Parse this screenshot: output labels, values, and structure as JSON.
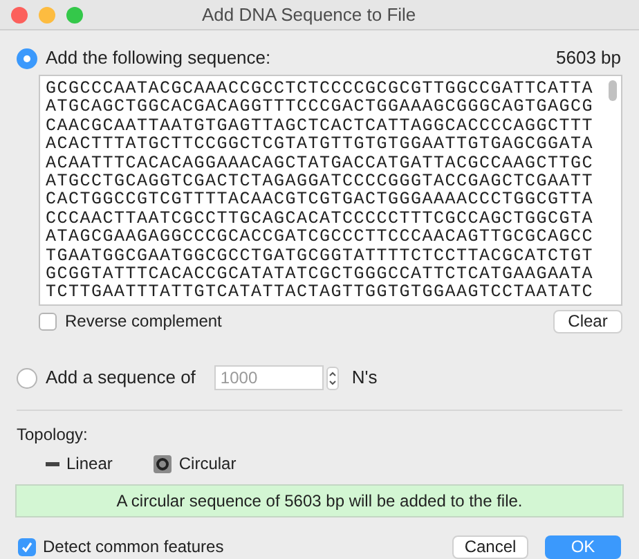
{
  "window": {
    "title": "Add DNA Sequence to File"
  },
  "source_options": [
    {
      "kind": "sequence",
      "label": "Add the following sequence:",
      "selected": true,
      "length": "5603 bp",
      "sequence_lines": [
        "GCGCCCAATACGCAAACCGCCTCTCCCCGCGCGTTGGCCGATTCATTA",
        "ATGCAGCTGGCACGACAGGTTTCCCGACTGGAAAGCGGGCAGTGAGCG",
        "CAACGCAATTAATGTGAGTTAGCTCACTCATTAGGCACCCCAGGCTTT",
        "ACACTTTATGCTTCCGGCTCGTATGTTGTGTGGAATTGTGAGCGGATA",
        "ACAATTTCACACAGGAAACAGCTATGACCATGATTACGCCAAGCTTGC",
        "ATGCCTGCAGGTCGACTCTAGAGGATCCCCGGGTACCGAGCTCGAATT",
        "CACTGGCCGTCGTTTTACAACGTCGTGACTGGGAAAACCCTGGCGTTA",
        "CCCAACTTAATCGCCTTGCAGCACATCCCCCTTTCGCCAGCTGGCGTA",
        "ATAGCGAAGAGGCCCGCACCGATCGCCCTTCCCAACAGTTGCGCAGCC",
        "TGAATGGCGAATGGCGCCTGATGCGGTATTTTCTCCTTACGCATCTGT",
        "GCGGTATTTCACACCGCATATATCGCTGGGCCATTCTCATGAAGAATA",
        "TCTTGAATTTATTGTCATATTACTAGTTGGTGTGGAAGTCCTAATATC"
      ],
      "reverse_complement": {
        "label": "Reverse complement",
        "checked": false
      },
      "clear_button": "Clear"
    },
    {
      "kind": "ns",
      "label": "Add a sequence of",
      "selected": false,
      "placeholder": "1000",
      "unit": "N's"
    }
  ],
  "topology": {
    "label": "Topology:",
    "options": [
      {
        "label": "Linear",
        "selected": false
      },
      {
        "label": "Circular",
        "selected": true
      }
    ]
  },
  "message": "A circular sequence of 5603 bp will be added to the file.",
  "detect_features": {
    "label": "Detect common features",
    "checked": true
  },
  "buttons": [
    {
      "label": "Cancel",
      "default": false
    },
    {
      "label": "OK",
      "default": true
    }
  ]
}
